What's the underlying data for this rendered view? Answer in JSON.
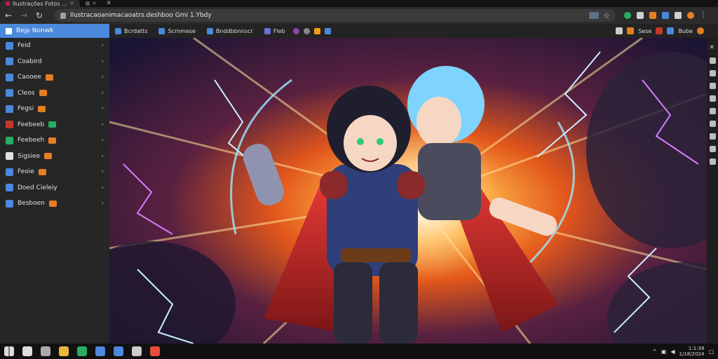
{
  "browser": {
    "tabs": [
      {
        "title": "Ilustrações Fotos ...",
        "active": true,
        "color": "#c2185b"
      },
      {
        "title": "",
        "active": false,
        "color": "#555"
      }
    ],
    "url": "Ilustracaoanimacaoatrs.deshboo Gmi 1.Ybdy",
    "colors": {
      "accent": "#4a89dc"
    }
  },
  "bookmarks": {
    "home_label": "Bejp Nonwk",
    "items": [
      {
        "label": "Bcrdatts",
        "color": "#4a89dc"
      },
      {
        "label": "Scrnmese",
        "color": "#4a89dc"
      },
      {
        "label": "Bnddbbnnscr",
        "color": "#4a89dc"
      },
      {
        "label": "Fleb",
        "color": "#6d6dd6"
      },
      {
        "label": "",
        "color": "#8e44ad"
      },
      {
        "label": "",
        "color": "#888"
      },
      {
        "label": "",
        "color": "#f39c12"
      },
      {
        "label": "",
        "color": "#4a89dc"
      }
    ],
    "right_items": [
      {
        "label": "",
        "color": "#ccc"
      },
      {
        "label": "Sese",
        "color": "#e67e22"
      },
      {
        "label": "",
        "color": "#c0392b"
      },
      {
        "label": "",
        "color": "#4a89dc"
      },
      {
        "label": "Bube",
        "color": "#4a89dc"
      },
      {
        "label": "",
        "color": "#e67e22"
      }
    ]
  },
  "sidebar": {
    "items": [
      {
        "label": "Feid",
        "icon": "page-icon",
        "color": "#4a89dc",
        "badge": null
      },
      {
        "label": "Coabird",
        "icon": "folder-icon",
        "color": "#4a89dc",
        "badge": null
      },
      {
        "label": "Caooee",
        "icon": "globe-icon",
        "color": "#4a89dc",
        "badge": "#e67e22"
      },
      {
        "label": "Cleos",
        "icon": "doc-icon",
        "color": "#4a89dc",
        "badge": "#e67e22"
      },
      {
        "label": "Fegsi",
        "icon": "page-icon",
        "color": "#4a89dc",
        "badge": "#e67e22"
      },
      {
        "label": "Feebeeb",
        "icon": "video-icon",
        "color": "#c0392b",
        "badge": "#27ae60"
      },
      {
        "label": "Feebeeh",
        "icon": "sheet-icon",
        "color": "#27ae60",
        "badge": "#e67e22"
      },
      {
        "label": "Sigsiee",
        "icon": "chrome-icon",
        "color": "#e0e0e0",
        "badge": "#e67e22"
      },
      {
        "label": "Feoie",
        "icon": "doc-icon",
        "color": "#4a89dc",
        "badge": "#e67e22"
      },
      {
        "label": "Doed Cieleiy",
        "icon": "page-icon",
        "color": "#4a89dc",
        "badge": null
      },
      {
        "label": "Besboen",
        "icon": "grid-icon",
        "color": "#4a89dc",
        "badge": "#e67e22"
      }
    ]
  },
  "taskbar": {
    "time": "1:1:38",
    "date": "1/18/2024",
    "apps": [
      {
        "icon": "search-icon",
        "color": "#ddd"
      },
      {
        "icon": "camera-icon",
        "color": "#aaa"
      },
      {
        "icon": "chrome-icon",
        "color": "#e8b73a"
      },
      {
        "icon": "excel-icon",
        "color": "#27ae60"
      },
      {
        "icon": "store-icon",
        "color": "#4a89dc"
      },
      {
        "icon": "home-icon",
        "color": "#4a89dc"
      },
      {
        "icon": "steam-icon",
        "color": "#ccc"
      },
      {
        "icon": "game-icon",
        "color": "#e74c3c"
      }
    ]
  }
}
